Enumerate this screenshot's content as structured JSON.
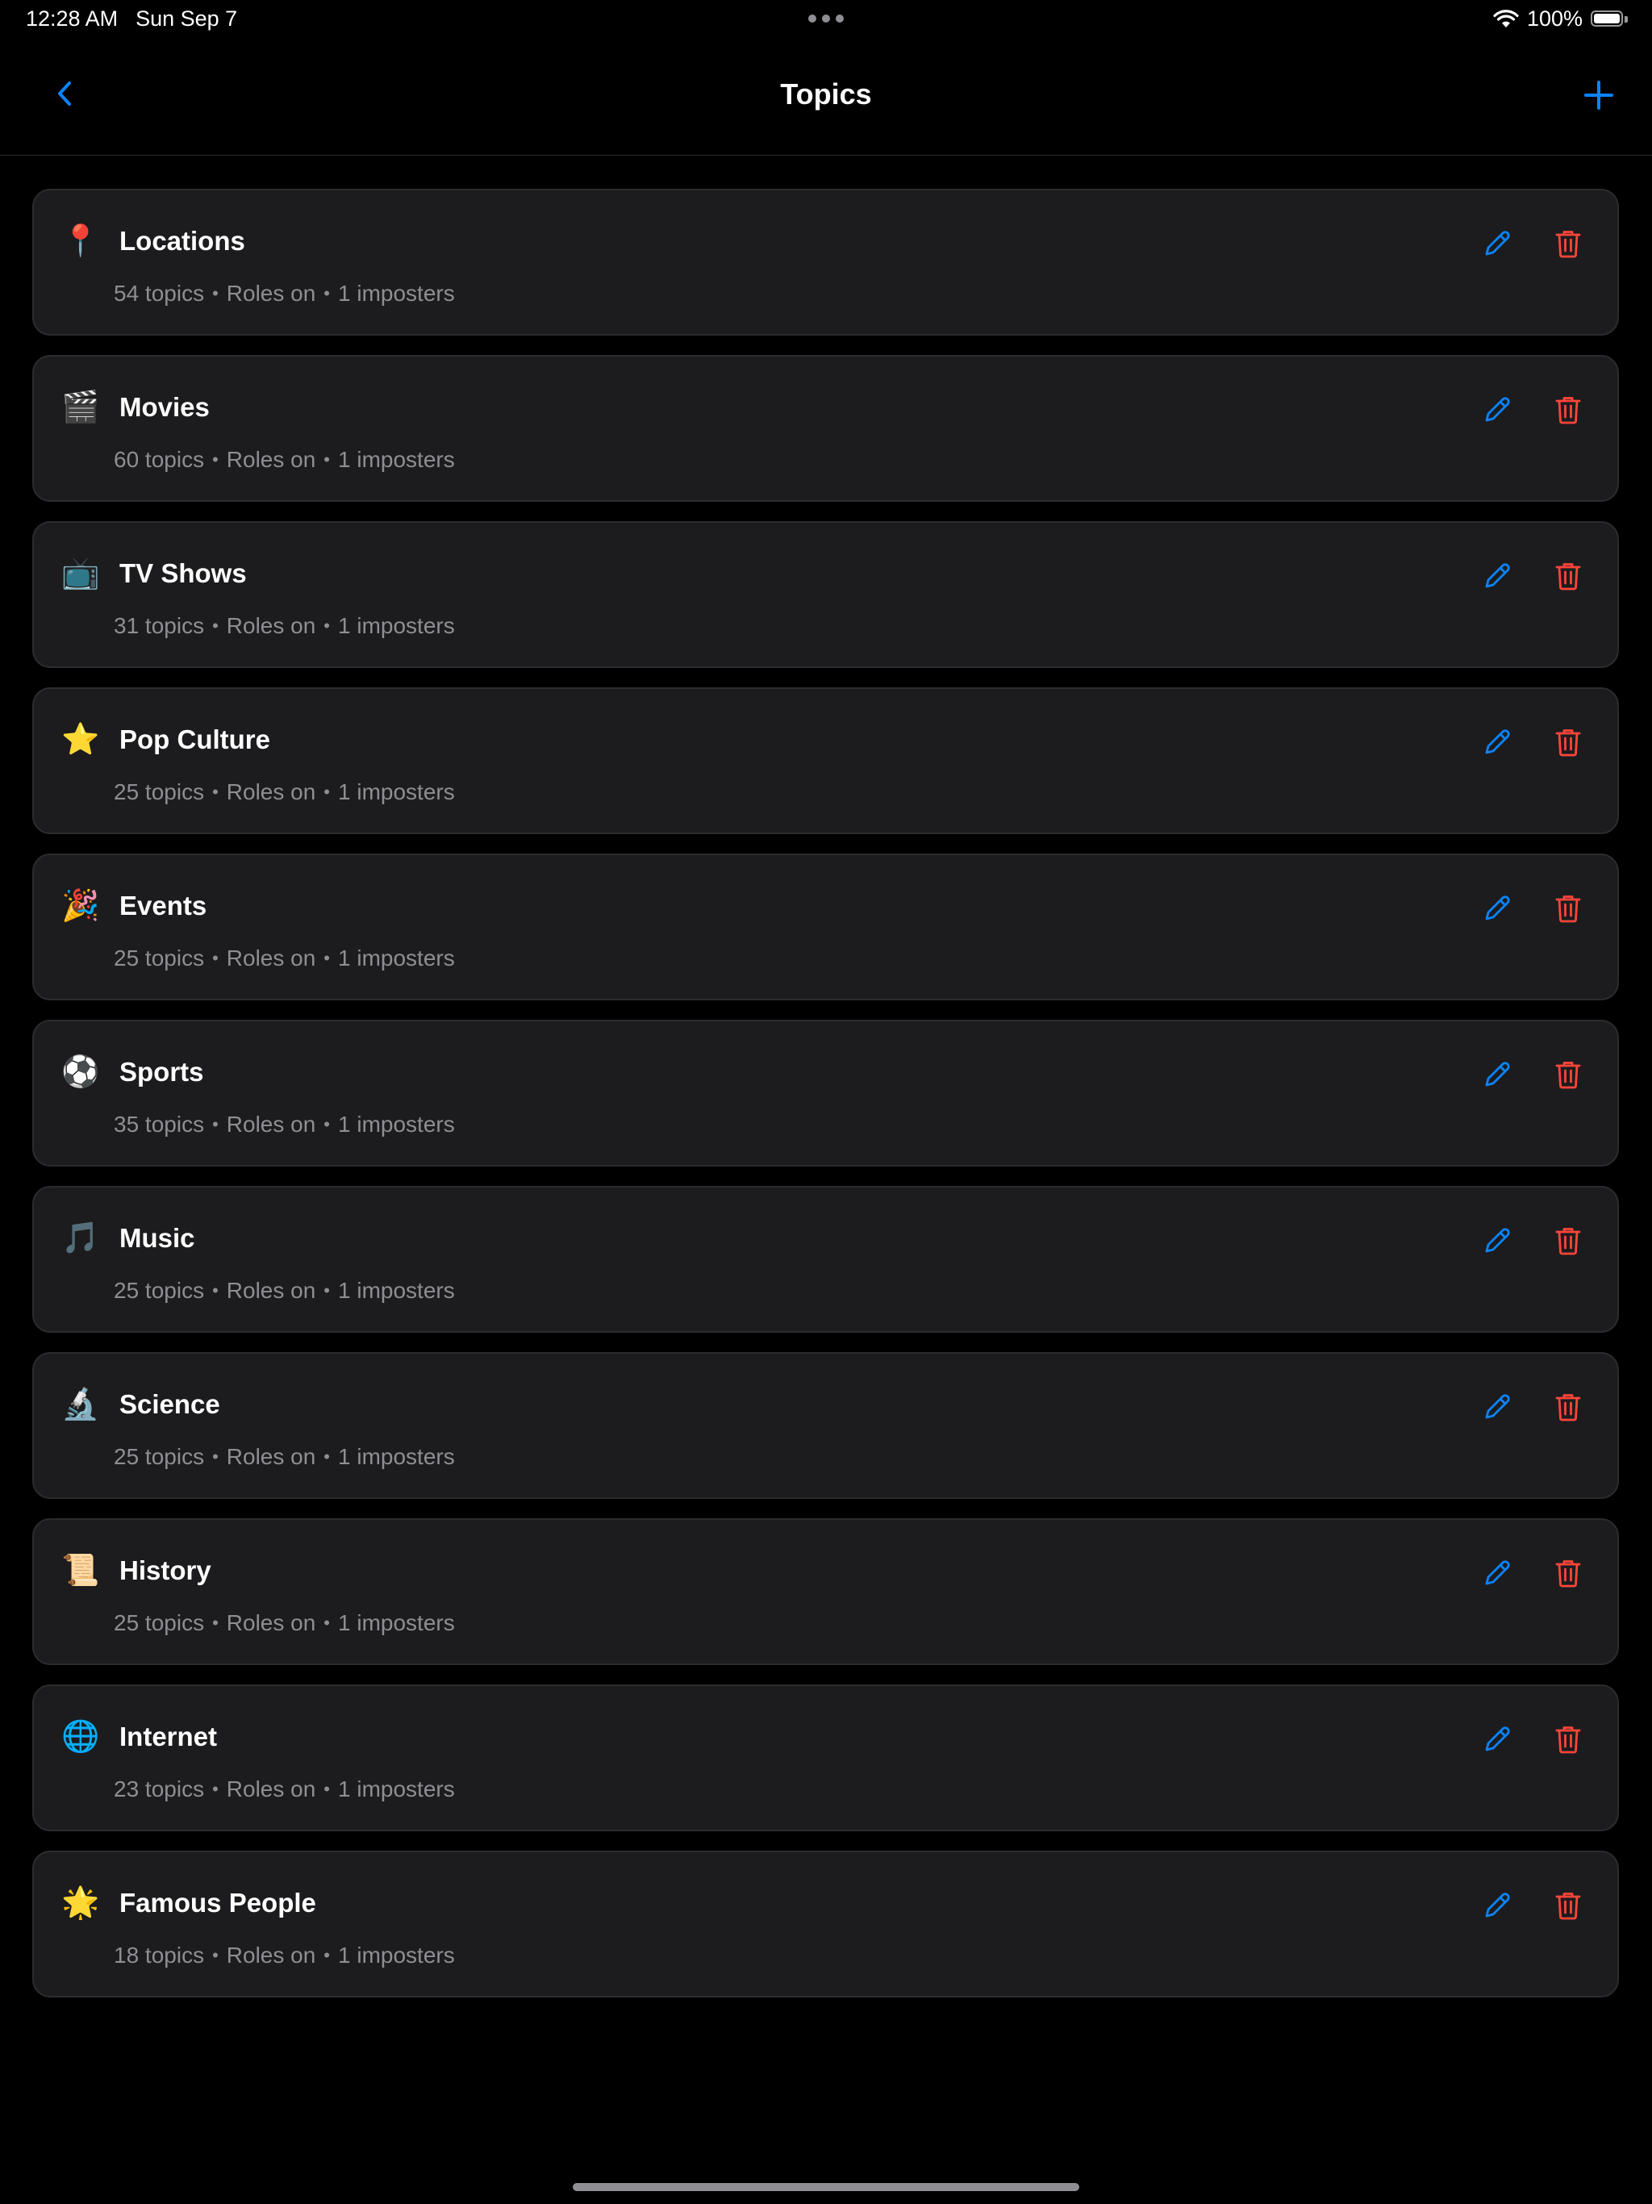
{
  "status_bar": {
    "time": "12:28 AM",
    "date": "Sun Sep 7",
    "battery": "100%"
  },
  "nav": {
    "title": "Topics",
    "back_icon": "chevron-left-icon",
    "add_icon": "plus-icon"
  },
  "colors": {
    "accent": "#0a84ff",
    "destructive": "#ff453a",
    "card_bg": "#1c1c1e",
    "secondary_text": "#8e8e93"
  },
  "topics": [
    {
      "emoji": "📍",
      "name": "Locations",
      "count": "54 topics",
      "roles": "Roles on",
      "imposters": "1 imposters"
    },
    {
      "emoji": "🎬",
      "name": "Movies",
      "count": "60 topics",
      "roles": "Roles on",
      "imposters": "1 imposters"
    },
    {
      "emoji": "📺",
      "name": "TV Shows",
      "count": "31 topics",
      "roles": "Roles on",
      "imposters": "1 imposters"
    },
    {
      "emoji": "⭐",
      "name": "Pop Culture",
      "count": "25 topics",
      "roles": "Roles on",
      "imposters": "1 imposters"
    },
    {
      "emoji": "🎉",
      "name": "Events",
      "count": "25 topics",
      "roles": "Roles on",
      "imposters": "1 imposters"
    },
    {
      "emoji": "⚽",
      "name": "Sports",
      "count": "35 topics",
      "roles": "Roles on",
      "imposters": "1 imposters"
    },
    {
      "emoji": "🎵",
      "name": "Music",
      "count": "25 topics",
      "roles": "Roles on",
      "imposters": "1 imposters"
    },
    {
      "emoji": "🔬",
      "name": "Science",
      "count": "25 topics",
      "roles": "Roles on",
      "imposters": "1 imposters"
    },
    {
      "emoji": "📜",
      "name": "History",
      "count": "25 topics",
      "roles": "Roles on",
      "imposters": "1 imposters"
    },
    {
      "emoji": "🌐",
      "name": "Internet",
      "count": "23 topics",
      "roles": "Roles on",
      "imposters": "1 imposters"
    },
    {
      "emoji": "🌟",
      "name": "Famous People",
      "count": "18 topics",
      "roles": "Roles on",
      "imposters": "1 imposters"
    }
  ]
}
